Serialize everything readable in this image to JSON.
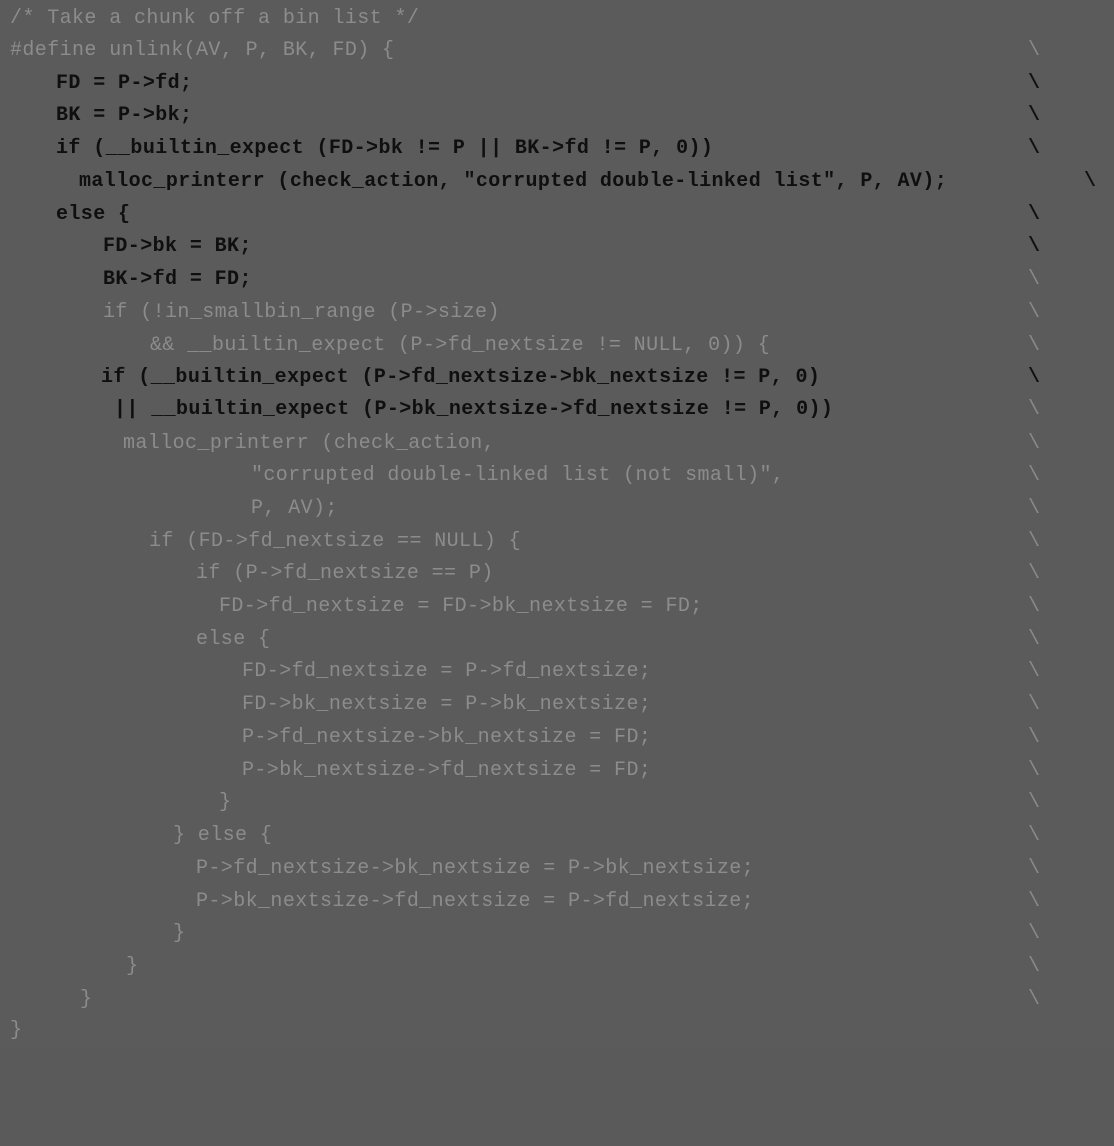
{
  "code_listing": {
    "lines": [
      {
        "text": "/* Take a chunk off a bin list */",
        "bs": "",
        "style": "dim"
      },
      {
        "text": "#define unlink(AV, P, BK, FD) {",
        "bs": "\\",
        "style": "dim"
      },
      {
        "text": "FD = P->fd;",
        "bs": "\\",
        "style": "hl"
      },
      {
        "text": "BK = P->bk;",
        "bs": "\\",
        "style": "hl"
      },
      {
        "text": "if (__builtin_expect (FD->bk != P || BK->fd != P, 0))",
        "bs": "\\",
        "style": "hl"
      },
      {
        "text": "malloc_printerr (check_action, \"corrupted double-linked list\", P, AV);",
        "bs": "\\",
        "style": "hl"
      },
      {
        "text": "else {",
        "bs": "\\",
        "style": "hl"
      },
      {
        "text": "FD->bk = BK;",
        "bs": "\\",
        "style": "hl"
      },
      {
        "text": "BK->fd = FD;",
        "bs": "\\",
        "style": "hl"
      },
      {
        "text": "if (!in_smallbin_range (P->size)",
        "bs": "\\",
        "style": "dim"
      },
      {
        "text": "&& __builtin_expect (P->fd_nextsize != NULL, 0)) {",
        "bs": "\\",
        "style": "dim"
      },
      {
        "text": "if (__builtin_expect (P->fd_nextsize->bk_nextsize != P, 0)",
        "bs": "\\",
        "style": "hl"
      },
      {
        "text": "|| __builtin_expect (P->bk_nextsize->fd_nextsize != P, 0))",
        "bs": "\\",
        "style": "hl"
      },
      {
        "text": "malloc_printerr (check_action,",
        "bs": "\\",
        "style": "dim"
      },
      {
        "text": "\"corrupted double-linked list (not small)\",",
        "bs": "\\",
        "style": "dim"
      },
      {
        "text": "P, AV);",
        "bs": "\\",
        "style": "dim"
      },
      {
        "text": "if (FD->fd_nextsize == NULL) {",
        "bs": "\\",
        "style": "dim"
      },
      {
        "text": "if (P->fd_nextsize == P)",
        "bs": "\\",
        "style": "dim"
      },
      {
        "text": "FD->fd_nextsize = FD->bk_nextsize = FD;",
        "bs": "\\",
        "style": "dim"
      },
      {
        "text": "else {",
        "bs": "\\",
        "style": "dim"
      },
      {
        "text": "FD->fd_nextsize = P->fd_nextsize;",
        "bs": "\\",
        "style": "dim"
      },
      {
        "text": "FD->bk_nextsize = P->bk_nextsize;",
        "bs": "\\",
        "style": "dim"
      },
      {
        "text": "P->fd_nextsize->bk_nextsize = FD;",
        "bs": "\\",
        "style": "dim"
      },
      {
        "text": "P->bk_nextsize->fd_nextsize = FD;",
        "bs": "\\",
        "style": "dim"
      },
      {
        "text": "}",
        "bs": "\\",
        "style": "dim"
      },
      {
        "text": "} else {",
        "bs": "\\",
        "style": "dim"
      },
      {
        "text": "P->fd_nextsize->bk_nextsize = P->bk_nextsize;",
        "bs": "\\",
        "style": "dim"
      },
      {
        "text": "P->bk_nextsize->fd_nextsize = P->fd_nextsize;",
        "bs": "\\",
        "style": "dim"
      },
      {
        "text": "}",
        "bs": "\\",
        "style": "dim"
      },
      {
        "text": "}",
        "bs": "\\",
        "style": "dim"
      },
      {
        "text": "}",
        "bs": "\\",
        "style": "dim"
      },
      {
        "text": "}",
        "bs": "",
        "style": "dim"
      }
    ]
  },
  "colors": {
    "background": "#5b5b5b",
    "dim_text": "#8c8c8c",
    "highlight_text": "#0f0f0f"
  }
}
